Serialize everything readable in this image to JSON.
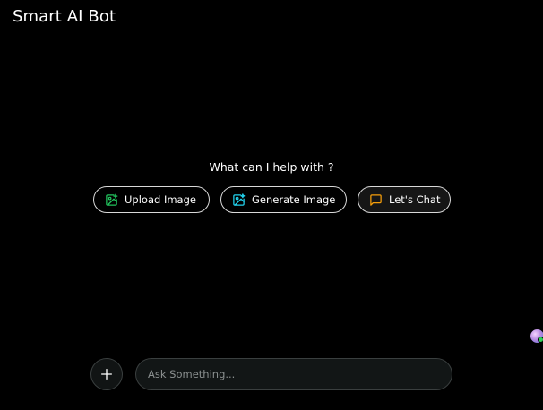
{
  "app": {
    "title": "Smart AI Bot"
  },
  "main": {
    "prompt": "What can I help with ?",
    "actions": [
      {
        "label": "Upload Image",
        "icon": "image-plus-icon",
        "color": "#22c55e"
      },
      {
        "label": "Generate Image",
        "icon": "image-sparkle-icon",
        "color": "#22d3ee"
      },
      {
        "label": "Let's Chat",
        "icon": "message-square-icon",
        "color": "#f59e0b"
      }
    ]
  },
  "composer": {
    "add_icon": "plus-icon",
    "placeholder": "Ask Something..."
  },
  "floating": {
    "icon": "assistant-avatar-icon"
  }
}
